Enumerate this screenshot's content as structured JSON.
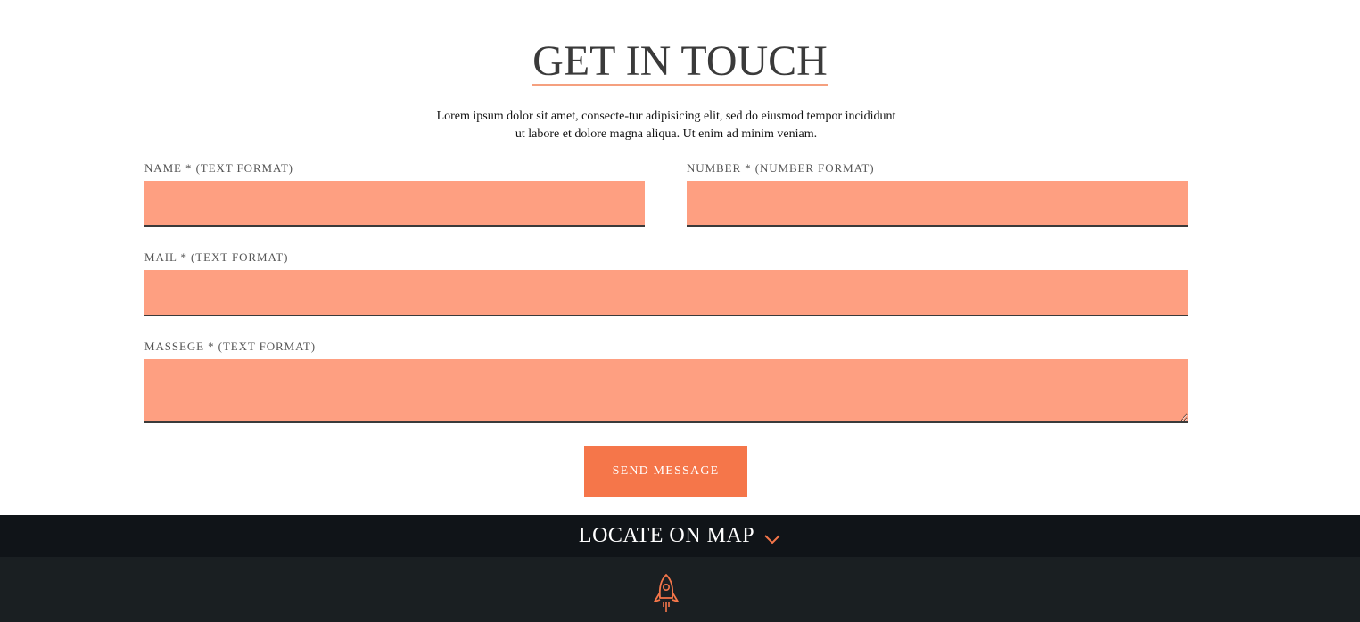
{
  "contact": {
    "title": "GET IN TOUCH",
    "intro_line1": "Lorem ipsum dolor sit amet, consecte-tur adipisicing elit, sed do eiusmod tempor incididunt",
    "intro_line2": "ut labore et dolore magna aliqua. Ut enim ad minim veniam.",
    "fields": {
      "name": {
        "label": "NAME * (TEXT FORMAT)",
        "value": "",
        "placeholder": ""
      },
      "number": {
        "label": "NUMBER * (NUMBER FORMAT)",
        "value": "",
        "placeholder": ""
      },
      "mail": {
        "label": "MAIL * (TEXT FORMAT)",
        "value": "",
        "placeholder": ""
      },
      "message": {
        "label": "MASSEGE * (TEXT FORMAT)",
        "value": "",
        "placeholder": ""
      }
    },
    "send_label": "SEND MESSAGE"
  },
  "map_bar": {
    "label": "LOCATE ON MAP",
    "icon": "chevron-down-icon"
  },
  "footer": {
    "icon": "rocket-icon"
  },
  "colors": {
    "accent": "#f5764a",
    "field_bg": "#fe9f81",
    "title_underline": "#f5a07f",
    "map_bar_bg": "#101418",
    "footer_bg": "#1a1f22"
  }
}
